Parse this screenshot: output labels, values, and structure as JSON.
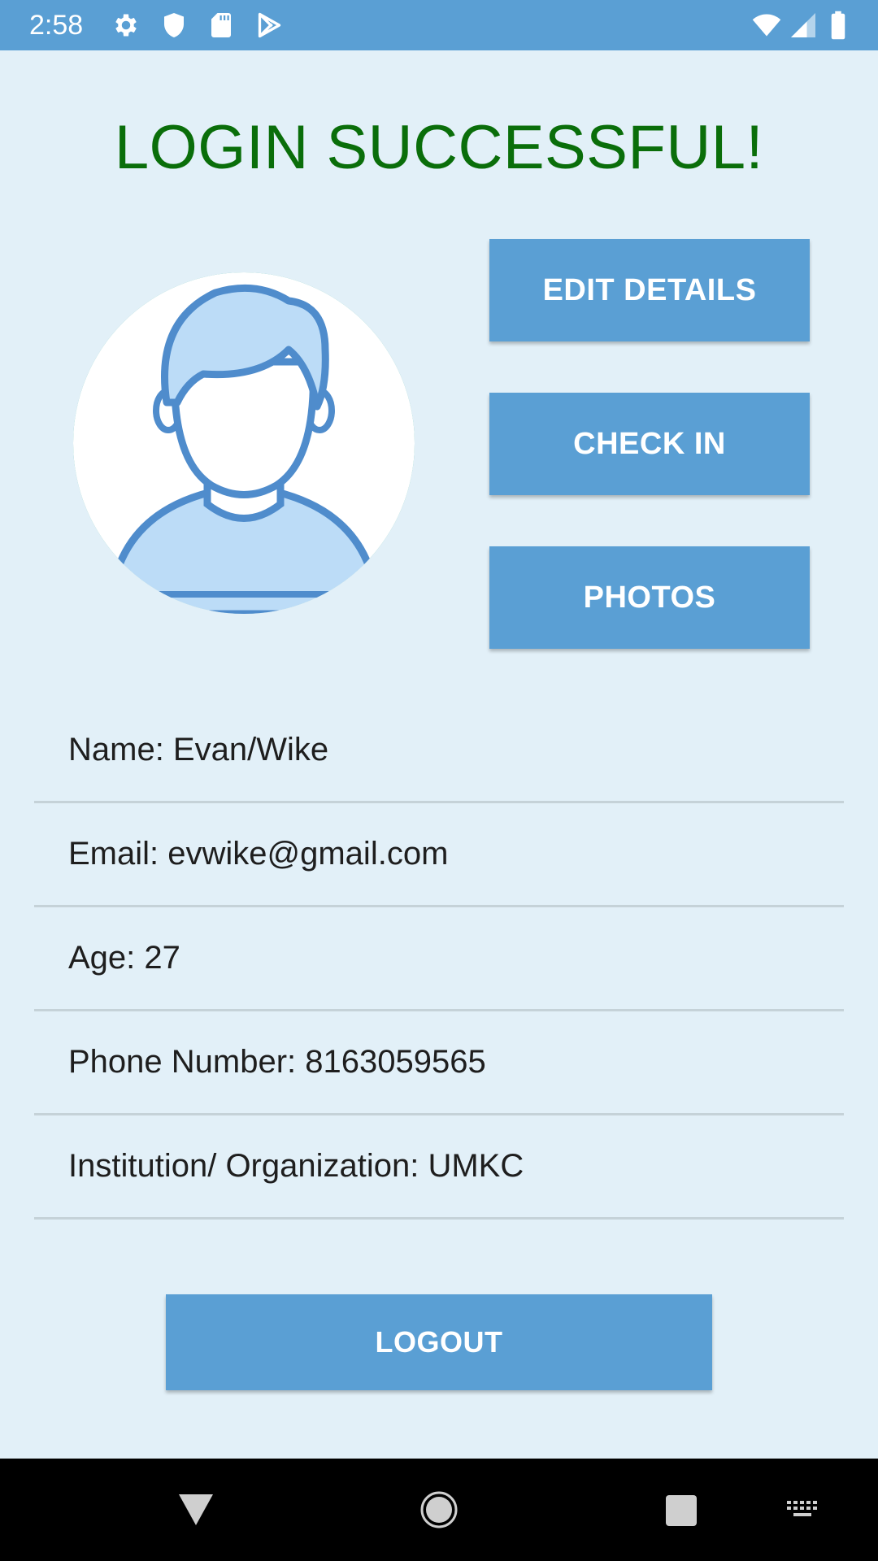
{
  "status_bar": {
    "time": "2:58",
    "icons": [
      "gear-icon",
      "shield-icon",
      "sd-card-icon",
      "play-store-icon",
      "wifi-icon",
      "signal-icon",
      "battery-icon"
    ],
    "color": "#5a9fd4"
  },
  "title": "LOGIN SUCCESSFUL!",
  "title_color": "#0a6e0a",
  "avatar": {
    "icon": "user-avatar-icon"
  },
  "buttons": {
    "edit_details": "EDIT DETAILS",
    "check_in": "CHECK IN",
    "photos": "PHOTOS",
    "logout": "LOGOUT"
  },
  "button_color": "#5a9fd4",
  "details": {
    "name": "Name: Evan/Wike",
    "email": "Email: evwike@gmail.com",
    "age": "Age: 27",
    "phone": "Phone Number: 8163059565",
    "institution": "Institution/ Organization: UMKC"
  },
  "nav_bar": {
    "icons": [
      "back-icon",
      "home-icon",
      "recents-icon",
      "keyboard-icon"
    ]
  }
}
